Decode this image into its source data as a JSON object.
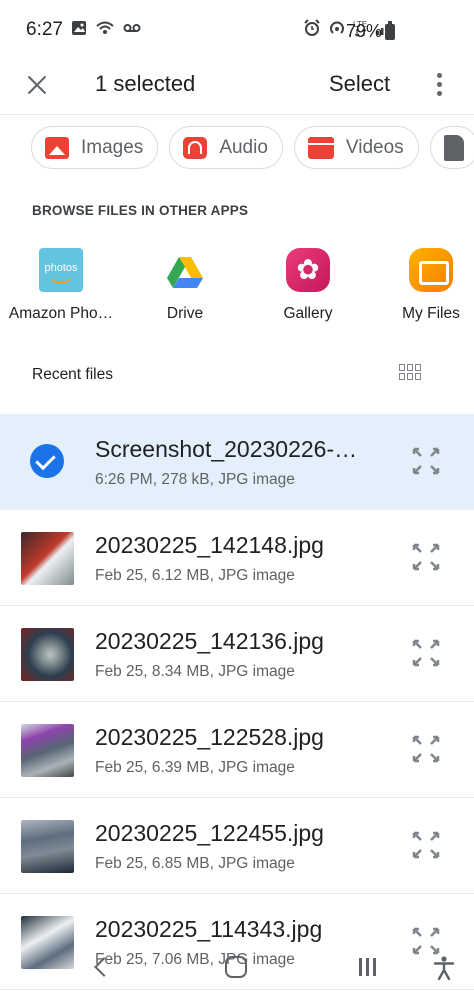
{
  "status_bar": {
    "time": "6:27",
    "battery": "79%",
    "icons": [
      "gallery-icon",
      "wifi-call-icon",
      "voicemail-icon",
      "alarm-icon",
      "hotspot-icon",
      "lte-icon",
      "signal-icon",
      "battery-icon"
    ]
  },
  "app_bar": {
    "title": "1 selected",
    "select_label": "Select",
    "close_icon": "close-icon",
    "more_icon": "more-vert-icon"
  },
  "chips": [
    {
      "label": "Images",
      "icon": "image-icon",
      "color": "#ea4335"
    },
    {
      "label": "Audio",
      "icon": "headphones-icon",
      "color": "#ea4335"
    },
    {
      "label": "Videos",
      "icon": "video-icon",
      "color": "#ea4335"
    },
    {
      "label": "",
      "icon": "document-icon",
      "color": "#5f6368"
    }
  ],
  "browse": {
    "header": "BROWSE FILES IN OTHER APPS",
    "apps": [
      {
        "label": "Amazon Pho…",
        "icon": "amazon-photos-icon",
        "icon_text": "photos"
      },
      {
        "label": "Drive",
        "icon": "google-drive-icon"
      },
      {
        "label": "Gallery",
        "icon": "gallery-app-icon"
      },
      {
        "label": "My Files",
        "icon": "my-files-icon"
      }
    ]
  },
  "recent": {
    "header": "Recent files",
    "grid_icon": "grid-view-icon"
  },
  "files": [
    {
      "name": "Screenshot_20230226-…",
      "meta": "6:26 PM, 278 kB, JPG image",
      "selected": true
    },
    {
      "name": "20230225_142148.jpg",
      "meta": "Feb 25, 6.12 MB, JPG image",
      "selected": false
    },
    {
      "name": "20230225_142136.jpg",
      "meta": "Feb 25, 8.34 MB, JPG image",
      "selected": false
    },
    {
      "name": "20230225_122528.jpg",
      "meta": "Feb 25, 6.39 MB, JPG image",
      "selected": false
    },
    {
      "name": "20230225_122455.jpg",
      "meta": "Feb 25, 6.85 MB, JPG image",
      "selected": false
    },
    {
      "name": "20230225_114343.jpg",
      "meta": "Feb 25, 7.06 MB, JPG image",
      "selected": false
    }
  ],
  "colors": {
    "selected_row": "#e3f0fb",
    "check": "#1a73e8",
    "chip_red": "#ea4335"
  },
  "nav_bar": {
    "icons": [
      "back-icon",
      "home-icon",
      "recents-icon",
      "accessibility-icon"
    ]
  }
}
